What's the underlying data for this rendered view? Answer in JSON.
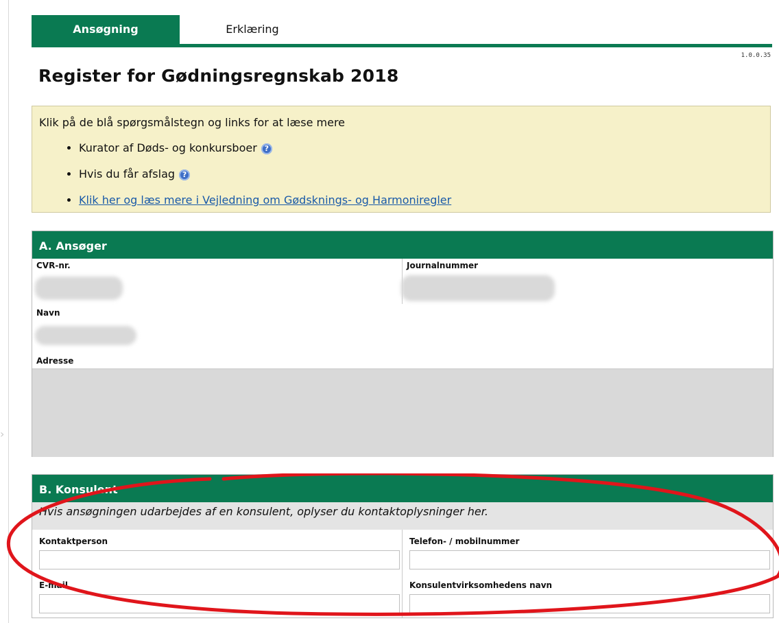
{
  "tabs": [
    {
      "label": "Ansøgning",
      "active": true
    },
    {
      "label": "Erklæring",
      "active": false
    }
  ],
  "version": "1.0.0.35",
  "page_title": "Register for Gødningsregnskab 2018",
  "info": {
    "intro": "Klik på de blå spørgsmålstegn og links for at læse mere",
    "items": [
      {
        "text": "Kurator af Døds- og konkursboer",
        "help_icon": "question-icon"
      },
      {
        "text": "Hvis du får afslag",
        "help_icon": "question-icon"
      },
      {
        "link": "Klik her og læs mere i Vejledning om Gødsknings- og Harmoniregler"
      }
    ]
  },
  "section_a": {
    "title": "A. Ansøger",
    "fields": {
      "cvr": {
        "label": "CVR-nr."
      },
      "journal": {
        "label": "Journalnummer"
      },
      "navn": {
        "label": "Navn"
      },
      "adresse": {
        "label": "Adresse"
      }
    }
  },
  "section_b": {
    "title": "B. Konsulent",
    "note": "Hvis ansøgningen udarbejdes af en konsulent, oplyser du kontaktoplysninger her.",
    "fields": {
      "kontaktperson": {
        "label": "Kontaktperson",
        "value": ""
      },
      "telefon": {
        "label": "Telefon- / mobilnummer",
        "value": ""
      },
      "email": {
        "label": "E-mail",
        "value": ""
      },
      "virksomhed": {
        "label": "Konsulentvirksomhedens navn",
        "value": ""
      }
    }
  },
  "colors": {
    "brand": "#0a7a52",
    "info_bg": "#f6f1c9",
    "link": "#1a5aa8",
    "annotation": "#e0151b"
  }
}
